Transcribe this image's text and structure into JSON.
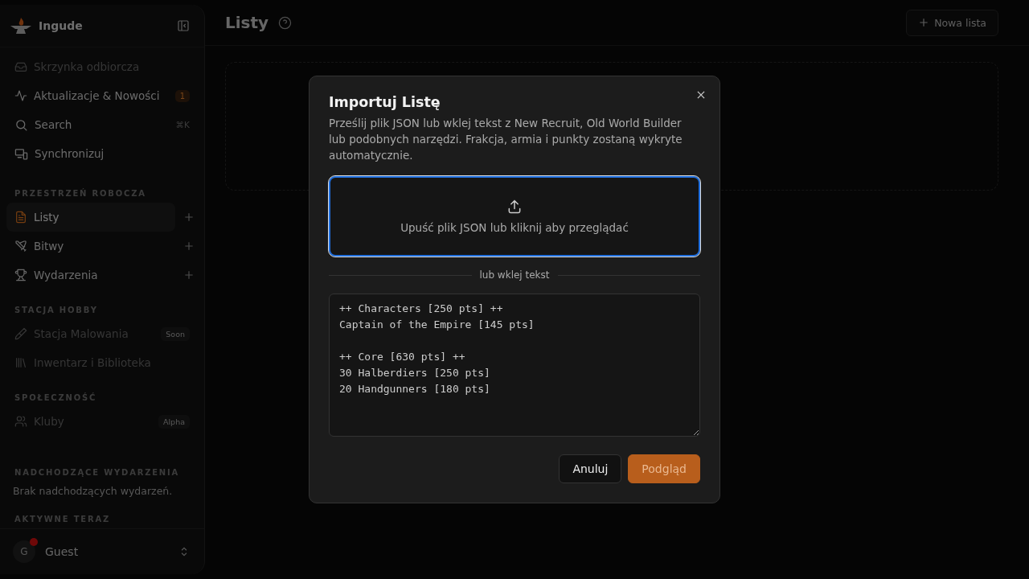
{
  "sidebar": {
    "brand": "Ingude",
    "nav": [
      {
        "label": "Skrzynka odbiorcza",
        "disabled": true
      },
      {
        "label": "Aktualizacje & Nowości",
        "disabled": false,
        "badge": "1"
      },
      {
        "label": "Search",
        "disabled": false,
        "shortcut": "⌘K"
      },
      {
        "label": "Synchronizuj",
        "disabled": false
      }
    ],
    "sections": [
      {
        "title": "PRZESTRZEŃ ROBOCZA",
        "items": [
          {
            "label": "Listy",
            "selected": true,
            "disabled": false,
            "add": true
          },
          {
            "label": "Bitwy",
            "selected": false,
            "disabled": false,
            "add": true
          },
          {
            "label": "Wydarzenia",
            "selected": false,
            "disabled": false,
            "add": true
          }
        ]
      },
      {
        "title": "STACJA HOBBY",
        "items": [
          {
            "label": "Stacja Malowania",
            "selected": false,
            "disabled": true,
            "tag": "Soon"
          },
          {
            "label": "Inwentarz i Biblioteka",
            "selected": false,
            "disabled": true
          }
        ]
      },
      {
        "title": "SPOŁECZNOŚĆ",
        "items": [
          {
            "label": "Kluby",
            "selected": false,
            "disabled": true,
            "tag": "Alpha"
          }
        ]
      }
    ],
    "upcoming": {
      "title": "NADCHODZĄCE WYDARZENIA",
      "empty": "Brak nadchodzących wydarzeń."
    },
    "active": {
      "title": "AKTYWNE TERAZ"
    },
    "user": {
      "initial": "G",
      "name": "Guest"
    }
  },
  "header": {
    "title": "Listy",
    "new_button": "Nowa lista"
  },
  "dialog": {
    "title": "Importuj Listę",
    "description": "Prześlij plik JSON lub wklej tekst z New Recruit, Old World Builder lub podobnych narzędzi. Frakcja, armia i punkty zostaną wykryte automatycznie.",
    "dropzone": {
      "text": "Upuść plik JSON lub kliknij aby przeglądać",
      "focused": true
    },
    "divider": "lub wklej tekst",
    "textarea": {
      "value": "++ Characters [250 pts] ++\nCaptain of the Empire [145 pts]\n\n++ Core [630 pts] ++\n30 Halberdiers [250 pts]\n20 Handgunners [180 pts]"
    },
    "buttons": [
      {
        "label": "Anuluj",
        "kind": "secondary"
      },
      {
        "label": "Podgląd",
        "kind": "primary"
      }
    ]
  }
}
